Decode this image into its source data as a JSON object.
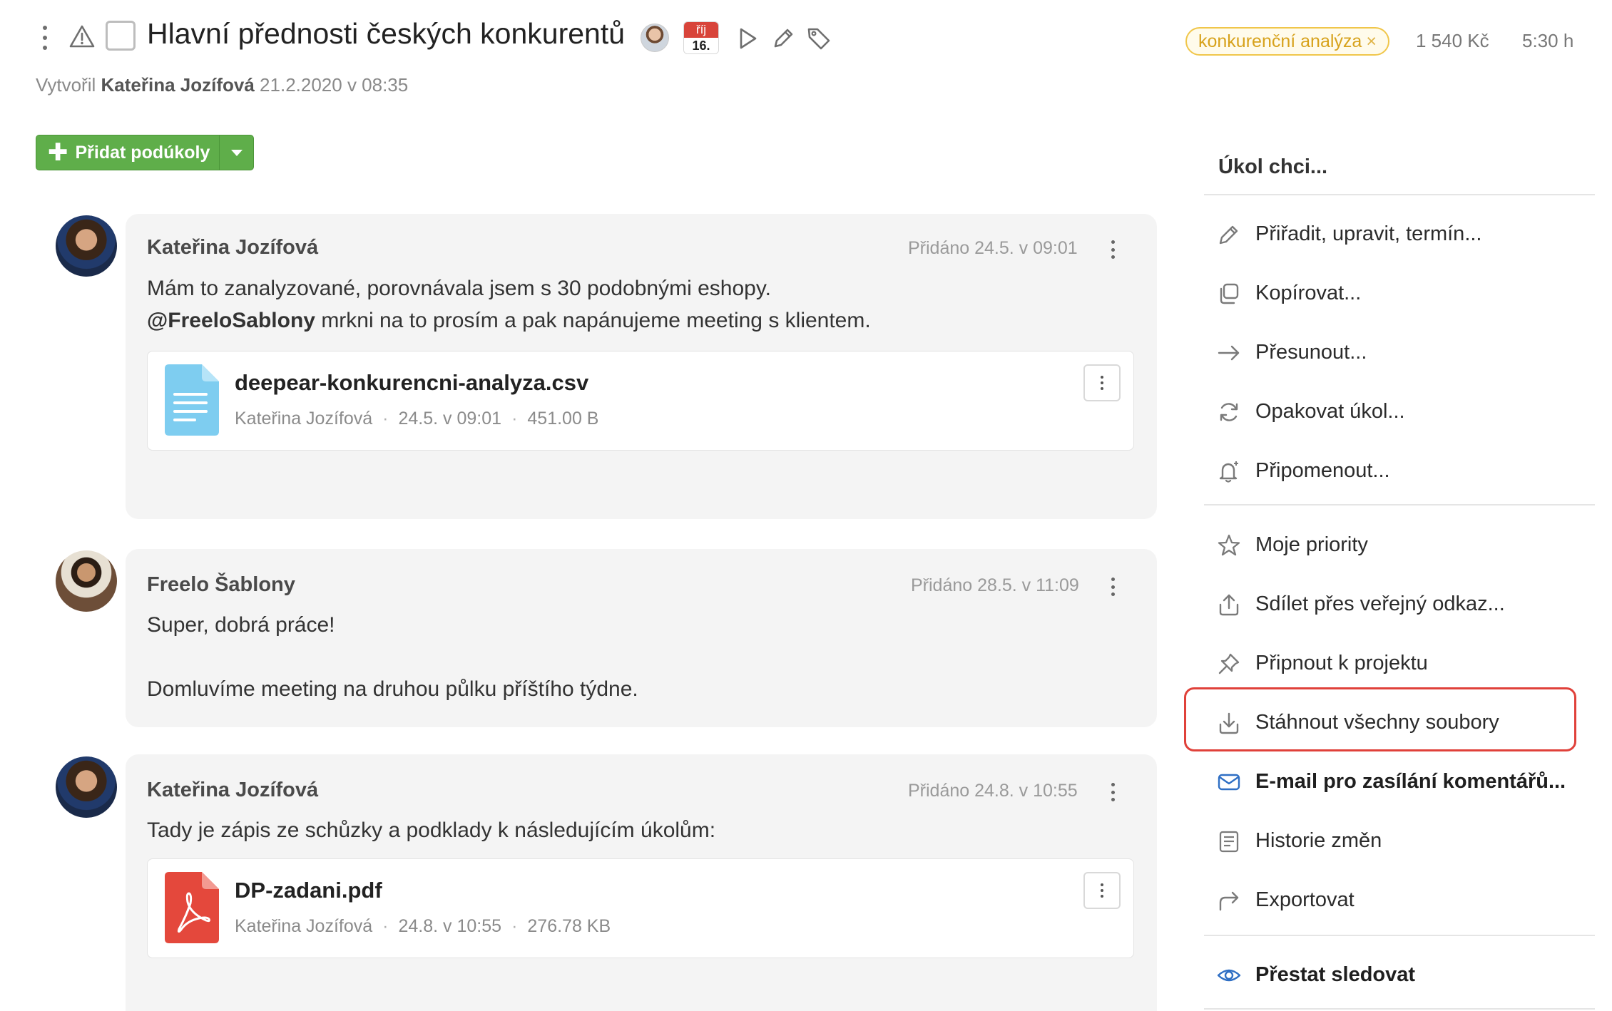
{
  "header": {
    "title": "Hlavní přednosti českých konkurentů",
    "calendar": {
      "month": "říj",
      "day": "16."
    },
    "created_prefix": "Vytvořil",
    "created_author": "Kateřina Jozífová",
    "created_date": "21.2.2020 v 08:35",
    "tag": {
      "label": "konkurenční analýza",
      "remove_glyph": "×",
      "color": "#f0c64a"
    },
    "price": "1 540 Kč",
    "hours": "5:30 h"
  },
  "add_subtasks": {
    "label": "Přidat podúkoly",
    "plus": "✚"
  },
  "comments": [
    {
      "author": "Kateřina Jozífová",
      "date": "Přidáno 24.5. v 09:01",
      "line1": "Mám to zanalyzované, porovnávala jsem s 30 podobnými eshopy.",
      "mention": "@FreeloSablony",
      "line2_rest": " mrkni na to prosím a pak napánujeme meeting s klientem.",
      "file": {
        "name": "deepear-konkurencni-analyza.csv",
        "author": "Kateřina Jozífová",
        "date": "24.5. v 09:01",
        "size": "451.00 B",
        "icon": "document-icon"
      }
    },
    {
      "author": "Freelo Šablony",
      "date": "Přidáno 28.5. v 11:09",
      "line1": "Super, dobrá práce!",
      "line2": "Domluvíme meeting na druhou půlku příštího týdne."
    },
    {
      "author": "Kateřina Jozífová",
      "date": "Přidáno 24.8. v 10:55",
      "line1": "Tady je zápis ze schůzky a podklady k následujícím úkolům:",
      "file": {
        "name": "DP-zadani.pdf",
        "author": "Kateřina Jozífová",
        "date": "24.8. v 10:55",
        "size": "276.78 KB",
        "icon": "pdf-icon"
      }
    }
  ],
  "menu": {
    "heading": "Úkol chci...",
    "items": [
      {
        "label": "Přiřadit, upravit, termín...",
        "icon": "pencil-icon"
      },
      {
        "label": "Kopírovat...",
        "icon": "copy-icon"
      },
      {
        "label": "Přesunout...",
        "icon": "arrow-right-icon"
      },
      {
        "label": "Opakovat úkol...",
        "icon": "repeat-icon"
      },
      {
        "label": "Připomenout...",
        "icon": "bell-icon"
      },
      {
        "label": "Moje priority",
        "icon": "star-icon"
      },
      {
        "label": "Sdílet přes veřejný odkaz...",
        "icon": "share-icon"
      },
      {
        "label": "Připnout k projektu",
        "icon": "pin-icon"
      },
      {
        "label": "Stáhnout všechny soubory",
        "icon": "download-icon"
      },
      {
        "label": "E-mail pro zasílání komentářů...",
        "icon": "email-icon"
      },
      {
        "label": "Historie změn",
        "icon": "history-icon"
      },
      {
        "label": "Exportovat",
        "icon": "export-icon"
      },
      {
        "label": "Přestat sledovat",
        "icon": "eye-icon"
      }
    ],
    "highlight_color": "#e0413a",
    "accent_color": "#2f6fc4"
  }
}
